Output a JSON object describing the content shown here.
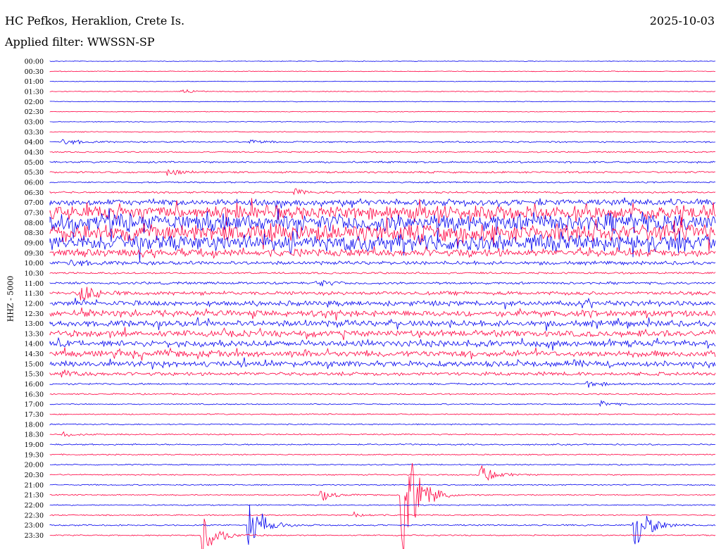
{
  "header": {
    "station": "HC Pefkos, Heraklion, Crete Is.",
    "date": "2025-10-03",
    "filter": "Applied filter: WWSSN-SP"
  },
  "channel_label": "HHZ - 5000",
  "colors": {
    "blue": "#0000ee",
    "red": "#ff0040",
    "text": "#000000"
  },
  "chart_data": {
    "type": "line",
    "title": "HC Pefkos, Heraklion, Crete Is.",
    "subtitle": "Applied filter: WWSSN-SP",
    "ylabel": "HHZ - 5000",
    "xlabel": "",
    "legend": "none",
    "grid": false,
    "line_color_cycle": [
      "blue",
      "red"
    ],
    "rows": [
      "00:00",
      "00:30",
      "01:00",
      "01:30",
      "02:00",
      "02:30",
      "03:00",
      "03:30",
      "04:00",
      "04:30",
      "05:00",
      "05:30",
      "06:00",
      "06:30",
      "07:00",
      "07:30",
      "08:00",
      "08:30",
      "09:00",
      "09:30",
      "10:00",
      "10:30",
      "11:00",
      "11:30",
      "12:00",
      "12:30",
      "13:00",
      "13:30",
      "14:00",
      "14:30",
      "15:00",
      "15:30",
      "16:00",
      "16:30",
      "17:00",
      "17:30",
      "18:00",
      "18:30",
      "19:00",
      "19:30",
      "20:00",
      "20:30",
      "21:00",
      "21:30",
      "22:00",
      "22:30",
      "23:00",
      "23:30"
    ],
    "noise_level": [
      0.5,
      0.6,
      0.5,
      0.6,
      0.6,
      0.6,
      0.6,
      0.8,
      1.2,
      1.0,
      1.5,
      1.5,
      1.2,
      1.5,
      5,
      11,
      14,
      14,
      13,
      6,
      3,
      1.5,
      2,
      3,
      4,
      5,
      5,
      5,
      5,
      5,
      4.5,
      3,
      1.5,
      1.2,
      1,
      1,
      1,
      1.1,
      1.2,
      1,
      1,
      1,
      1,
      1,
      1,
      1,
      1.2,
      1
    ],
    "events": [
      {
        "row": "01:30",
        "x": 0.2,
        "amp": 3
      },
      {
        "row": "04:00",
        "x": 0.02,
        "amp": 7
      },
      {
        "row": "04:00",
        "x": 0.3,
        "amp": 4
      },
      {
        "row": "05:30",
        "x": 0.18,
        "amp": 6
      },
      {
        "row": "06:30",
        "x": 0.37,
        "amp": 5
      },
      {
        "row": "10:00",
        "x": 0.03,
        "amp": 8
      },
      {
        "row": "11:00",
        "x": 0.4,
        "amp": 6
      },
      {
        "row": "11:30",
        "x": 0.05,
        "amp": 14
      },
      {
        "row": "15:30",
        "x": 0.02,
        "amp": 6
      },
      {
        "row": "16:00",
        "x": 0.81,
        "amp": 6
      },
      {
        "row": "17:00",
        "x": 0.83,
        "amp": 5
      },
      {
        "row": "18:30",
        "x": 0.02,
        "amp": 4
      },
      {
        "row": "20:30",
        "x": 0.65,
        "amp": 16
      },
      {
        "row": "21:30",
        "x": 0.41,
        "amp": 10
      },
      {
        "row": "22:30",
        "x": 0.46,
        "amp": 4
      },
      {
        "row": "21:30",
        "x": 0.53,
        "amp": 140
      },
      {
        "row": "23:00",
        "x": 0.3,
        "amp": 45
      },
      {
        "row": "23:00",
        "x": 0.88,
        "amp": 45
      },
      {
        "row": "23:30",
        "x": 0.23,
        "amp": 40
      }
    ]
  }
}
